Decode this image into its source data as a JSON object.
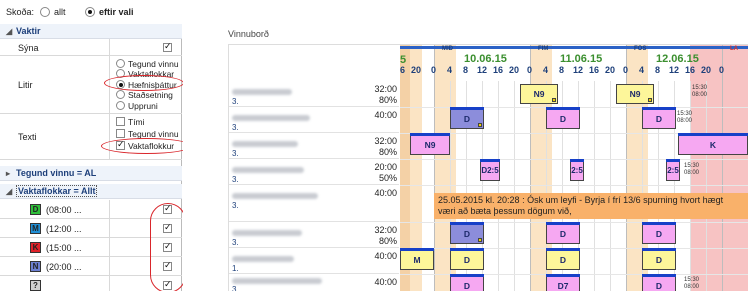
{
  "skoda": {
    "label": "Skoða:",
    "options": [
      {
        "label": "allt",
        "selected": false
      },
      {
        "label": "eftir vali",
        "selected": true
      }
    ]
  },
  "left": {
    "vaktir_header": "Vaktir",
    "syna": {
      "label": "Sýna",
      "checked": true
    },
    "litir": {
      "label": "Litir",
      "options": [
        {
          "label": "Tegund vinnu",
          "selected": false
        },
        {
          "label": "Vaktaflokkar",
          "selected": false
        },
        {
          "label": "Hæfnisþáttur",
          "selected": true
        },
        {
          "label": "Staðsetning",
          "selected": false
        },
        {
          "label": "Uppruni",
          "selected": false
        }
      ]
    },
    "texti": {
      "label": "Texti",
      "options": [
        {
          "label": "Tími",
          "checked": false
        },
        {
          "label": "Tegund vinnu",
          "checked": false
        },
        {
          "label": "Vaktaflokkur",
          "checked": true
        }
      ]
    },
    "tegund_header": "Tegund vinnu = AL",
    "vaktaflokkar_header": "Vaktaflokkar = Allt",
    "vaktaflokkar": [
      {
        "code": "D",
        "text": "(08:00 ...",
        "color": "#2fbf3a",
        "checked": true
      },
      {
        "code": "M",
        "text": "(12:00 ...",
        "color": "#1f8fd6",
        "checked": true
      },
      {
        "code": "K",
        "text": "(15:00 ...",
        "color": "#e0222a",
        "checked": true
      },
      {
        "code": "N",
        "text": "(20:00 ...",
        "color": "#6c7fd1",
        "checked": true
      },
      {
        "code": "?",
        "text": "",
        "color": "#cfcfcf",
        "checked": true
      }
    ]
  },
  "schedule": {
    "title": "Vinnuborð",
    "days": [
      {
        "dow": "MIÐ",
        "date": "10.06.15"
      },
      {
        "dow": "FIM",
        "date": "11.06.15"
      },
      {
        "dow": "FÖS",
        "date": "12.06.15"
      },
      {
        "dow": "LA",
        "date": ""
      }
    ],
    "hour_labels": [
      "5",
      "6",
      "20",
      "0",
      "4",
      "8",
      "12",
      "16",
      "20",
      "0",
      "4",
      "8",
      "12",
      "16",
      "20",
      "0",
      "4",
      "8",
      "12",
      "16",
      "20",
      "0"
    ],
    "employees": [
      {
        "hours": "32:00",
        "pct": "80%",
        "sub": "3."
      },
      {
        "hours": "40:00",
        "pct": "",
        "sub": "3."
      },
      {
        "hours": "32:00",
        "pct": "80%",
        "sub": "3."
      },
      {
        "hours": "20:00",
        "pct": "50%",
        "sub": "3."
      },
      {
        "hours": "40:00",
        "pct": "",
        "sub": "3."
      },
      {
        "hours": "32:00",
        "pct": "80%",
        "sub": "3."
      },
      {
        "hours": "40:00",
        "pct": "",
        "sub": "1."
      },
      {
        "hours": "40:00",
        "pct": "",
        "sub": "3."
      }
    ],
    "shifts": {
      "n9_a": "N9",
      "n9_b": "N9",
      "d_1": "D",
      "d_2": "D",
      "d_3": "D",
      "n9_c": "N9",
      "k_1": "K",
      "d25_a": "D2:5",
      "d25_b": "2:5",
      "d25_c": "2:5",
      "d_4": "D",
      "d_5": "D",
      "d_6": "D",
      "m_1": "M",
      "d_7": "D",
      "d_8": "D",
      "d_9": "D",
      "d_10": "D",
      "d7": "D7",
      "d_11": "D"
    },
    "tiny_times": {
      "t1a": "15:30",
      "t1b": "08:00",
      "t2a": "15:30",
      "t2b": "08:00",
      "t3a": "15:30",
      "t3b": "08:00",
      "t4a": "15:30",
      "t4b": "08:00"
    },
    "note": {
      "line1": "25.05.2015 kl. 20:28 : Ósk um leyfi - Byrja í frí 13/6 spurning hvort hægt",
      "line2": "væri að bæta þessum dögum við,"
    },
    "colors": {
      "yellow": "#fdf69a",
      "purple": "#8c8ddb",
      "pink": "#f6a8f2",
      "peach": "#fbe4c4",
      "salmon": "#f7c3c3"
    }
  }
}
